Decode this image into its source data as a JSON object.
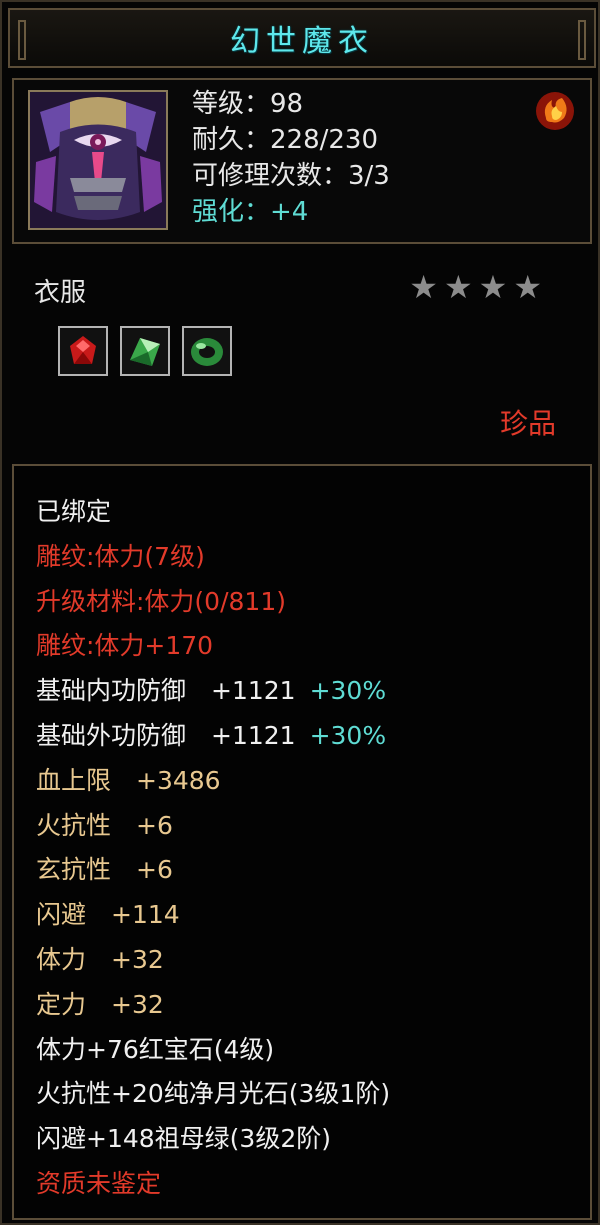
{
  "title": "幻世魔衣",
  "stats": {
    "level": "等级：98",
    "durability": "耐久：228/230",
    "repairs": "可修理次数：3/3",
    "enhance": "强化：+4"
  },
  "category": "衣服",
  "stars": {
    "lit": 0,
    "total": 4
  },
  "gems": [
    "ruby-icon",
    "emerald-icon",
    "jade-ring-icon"
  ],
  "rarity": "珍品",
  "attributes": {
    "bound": "已绑定",
    "engrave": "雕纹:体力(7级)",
    "upgrade_material": "升级材料:体力(0/811)",
    "engrave_bonus": "雕纹:体力+170",
    "inner_def": "基础内功防御　+1121",
    "inner_def_pct": "+30%",
    "outer_def": "基础外功防御　+1121",
    "outer_def_pct": "+30%",
    "hp": "血上限　+3486",
    "fire_res": "火抗性　+6",
    "mystic_res": "玄抗性　+6",
    "dodge": "闪避　+114",
    "stamina": "体力　+32",
    "focus": "定力　+32",
    "gem1": "体力+76红宝石(4级)",
    "gem2": "火抗性+20纯净月光石(3级1阶)",
    "gem3": "闪避+148祖母绿(3级2阶)",
    "quality": "资质未鉴定"
  },
  "colors": {
    "title": "#5ee8ec",
    "red": "#e23a2a",
    "gold": "#e8c890",
    "cyan": "#5fdcd4",
    "border": "#5b4d38"
  }
}
